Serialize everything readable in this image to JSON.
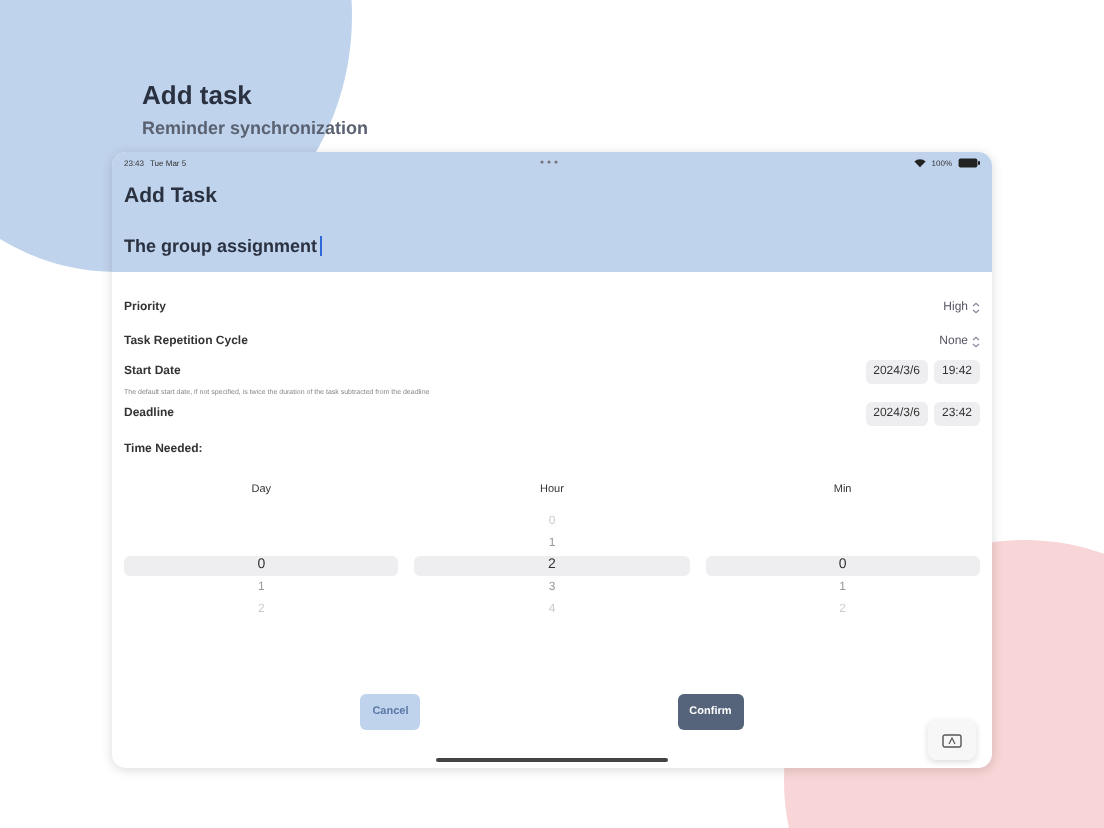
{
  "header": {
    "title": "Add task",
    "subtitle": "Reminder synchronization"
  },
  "status_bar": {
    "time": "23:43",
    "date": "Tue Mar 5",
    "battery": "100%"
  },
  "screen": {
    "title": "Add Task",
    "task_name": {
      "value": "The group assignment",
      "focused": true
    },
    "settings": [
      {
        "kind": "menu",
        "label": "Priority",
        "value": "High"
      },
      {
        "kind": "menu",
        "label": "Task Repetition Cycle",
        "value": "None"
      },
      {
        "kind": "datetime",
        "label": "Start Date",
        "date": "2024/3/6",
        "time": "19:42",
        "note": "The default start date, if not specified, is twice the duration of the task subtracted from the deadline"
      },
      {
        "kind": "datetime",
        "label": "Deadline",
        "date": "2024/3/6",
        "time": "23:42"
      }
    ],
    "time_needed": {
      "label": "Time Needed:",
      "columns": [
        {
          "heading": "Day",
          "items": [
            {
              "label": "0",
              "selected": true
            },
            {
              "label": "1",
              "selected": false
            },
            {
              "label": "2",
              "selected": false
            }
          ]
        },
        {
          "heading": "Hour",
          "items": [
            {
              "label": "0",
              "selected": false
            },
            {
              "label": "1",
              "selected": false
            },
            {
              "label": "2",
              "selected": true
            },
            {
              "label": "3",
              "selected": false
            },
            {
              "label": "4",
              "selected": false
            }
          ]
        },
        {
          "heading": "Min",
          "items": [
            {
              "label": "0",
              "selected": true
            },
            {
              "label": "1",
              "selected": false
            },
            {
              "label": "2",
              "selected": false
            }
          ]
        }
      ]
    },
    "buttons": [
      {
        "label": "Cancel",
        "kind": "secondary",
        "disabled": true
      },
      {
        "label": "Confirm",
        "kind": "primary",
        "disabled": false
      }
    ]
  }
}
